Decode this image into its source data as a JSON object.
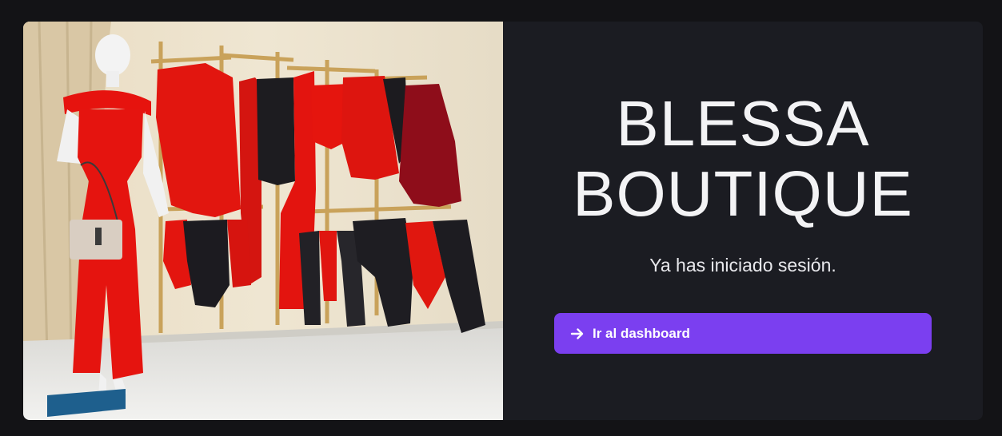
{
  "brand": {
    "title_line1": "BLESSA",
    "title_line2": "BOUTIQUE"
  },
  "status": {
    "message": "Ya has iniciado sesión."
  },
  "actions": {
    "dashboard_label": "Ir al dashboard",
    "dashboard_icon": "arrow-right-icon"
  },
  "hero_image": {
    "subject": "boutique-storefront-photo"
  },
  "colors": {
    "page_bg": "#131316",
    "panel_bg": "#1b1c22",
    "accent": "#7b3ff0",
    "text": "#f3f3f5"
  }
}
